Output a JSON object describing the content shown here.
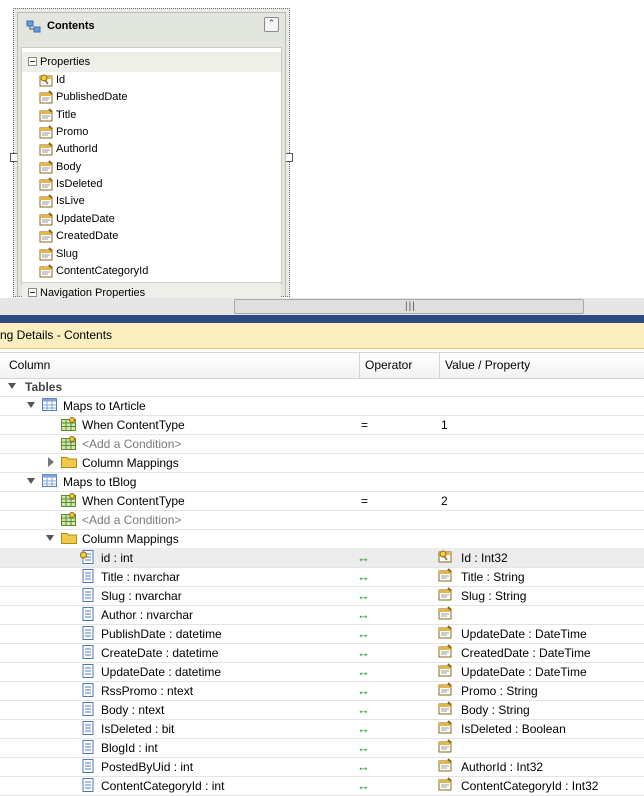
{
  "entity": {
    "title": "Contents",
    "sections": {
      "properties": "Properties",
      "navigation": "Navigation Properties"
    },
    "properties": [
      {
        "name": "Id",
        "key": true
      },
      {
        "name": "PublishedDate",
        "key": false
      },
      {
        "name": "Title",
        "key": false
      },
      {
        "name": "Promo",
        "key": false
      },
      {
        "name": "AuthorId",
        "key": false
      },
      {
        "name": "Body",
        "key": false
      },
      {
        "name": "IsDeleted",
        "key": false
      },
      {
        "name": "IsLive",
        "key": false
      },
      {
        "name": "UpdateDate",
        "key": false
      },
      {
        "name": "CreatedDate",
        "key": false
      },
      {
        "name": "Slug",
        "key": false
      },
      {
        "name": "ContentCategoryId",
        "key": false
      }
    ]
  },
  "mapping": {
    "panel_title": "ng Details - Contents",
    "columns": {
      "column": "Column",
      "operator": "Operator",
      "value": "Value / Property"
    },
    "tables_label": "Tables",
    "article": {
      "maps_to": "Maps to tArticle",
      "condition": {
        "label": "When ContentType",
        "operator": "=",
        "value": "1"
      },
      "add_condition": "<Add a Condition>",
      "column_mappings": "Column Mappings"
    },
    "blog": {
      "maps_to": "Maps to tBlog",
      "condition": {
        "label": "When ContentType",
        "operator": "=",
        "value": "2"
      },
      "add_condition": "<Add a Condition>",
      "column_mappings": "Column Mappings",
      "arrow": "↔",
      "rows": [
        {
          "column": "id : int",
          "property": "Id : Int32",
          "key": true
        },
        {
          "column": "Title : nvarchar",
          "property": "Title : String",
          "key": false
        },
        {
          "column": "Slug : nvarchar",
          "property": "Slug : String",
          "key": false
        },
        {
          "column": "Author : nvarchar",
          "property": "",
          "key": false
        },
        {
          "column": "PublishDate : datetime",
          "property": "UpdateDate : DateTime",
          "key": false
        },
        {
          "column": "CreateDate : datetime",
          "property": "CreatedDate : DateTime",
          "key": false
        },
        {
          "column": "UpdateDate : datetime",
          "property": "UpdateDate : DateTime",
          "key": false
        },
        {
          "column": "RssPromo : ntext",
          "property": "Promo : String",
          "key": false
        },
        {
          "column": "Body : ntext",
          "property": "Body : String",
          "key": false
        },
        {
          "column": "IsDeleted : bit",
          "property": "IsDeleted : Boolean",
          "key": false
        },
        {
          "column": "BlogId : int",
          "property": "",
          "key": false
        },
        {
          "column": "PostedByUid : int",
          "property": "AuthorId : Int32",
          "key": false
        },
        {
          "column": "ContentCategoryId : int",
          "property": "ContentCategoryId : Int32",
          "key": false
        }
      ]
    }
  },
  "scrollbar": {
    "grip": "|||"
  }
}
